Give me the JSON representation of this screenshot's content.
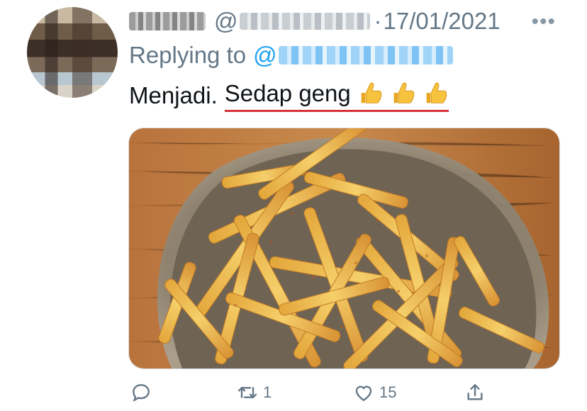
{
  "tweet": {
    "separator": "·",
    "at_symbol": "@",
    "date": "17/01/2021",
    "replying_to_label": "Replying to",
    "reply_at_symbol": "@",
    "text_plain": "Menjadi.",
    "text_underlined": "Sedap geng",
    "emoji_icons": [
      "thumbs-up-icon",
      "thumbs-up-icon",
      "thumbs-up-icon"
    ],
    "image_alt": "plate of french fries"
  },
  "actions": {
    "reply_count": "",
    "retweet_count": "1",
    "like_count": "15"
  },
  "colors": {
    "muted": "#657786",
    "link": "#1da1f2",
    "underline": "#d6323a"
  }
}
